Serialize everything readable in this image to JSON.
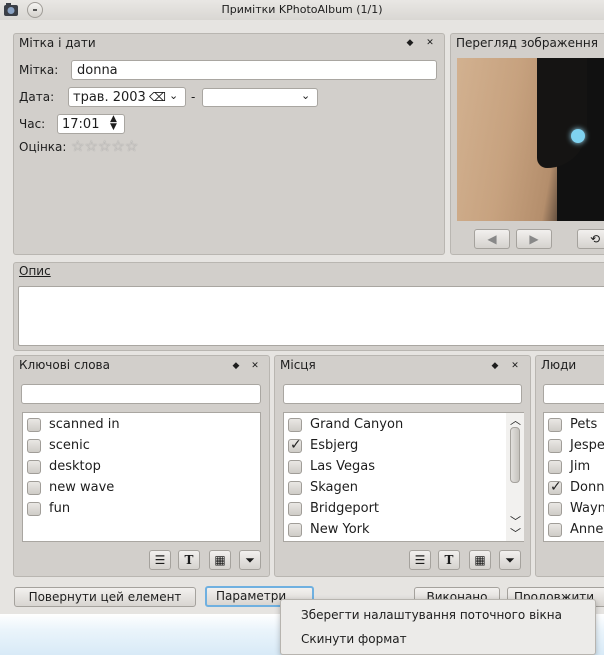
{
  "window": {
    "title": "Примітки KPhotoAlbum (1/1)"
  },
  "labels_panel": {
    "title": "Мітка і дати",
    "label_caption": "Мітка:",
    "label_value": "donna",
    "date_caption": "Дата:",
    "date_from": "трав. 2003",
    "date_separator": "-",
    "date_to": "",
    "time_caption": "Час:",
    "time_value": "17:01",
    "rating_caption": "Оцінка:",
    "rating": 0,
    "rating_max": 5
  },
  "preview_panel": {
    "title": "Перегляд зображення"
  },
  "description_panel": {
    "title": "Опис",
    "value": ""
  },
  "keywords_panel": {
    "title": "Ключові слова",
    "search": "",
    "items": [
      {
        "label": "scanned in",
        "checked": false
      },
      {
        "label": "scenic",
        "checked": false
      },
      {
        "label": "desktop",
        "checked": false
      },
      {
        "label": "new wave",
        "checked": false
      },
      {
        "label": "fun",
        "checked": false
      }
    ]
  },
  "places_panel": {
    "title": "Місця",
    "search": "",
    "items": [
      {
        "label": "Grand Canyon",
        "checked": false
      },
      {
        "label": "Esbjerg",
        "checked": true
      },
      {
        "label": "Las Vegas",
        "checked": false
      },
      {
        "label": "Skagen",
        "checked": false
      },
      {
        "label": "Bridgeport",
        "checked": false
      },
      {
        "label": "New York",
        "checked": false
      }
    ]
  },
  "people_panel": {
    "title": "Люди",
    "search": "",
    "items": [
      {
        "label": "Pets",
        "checked": false
      },
      {
        "label": "Jespe",
        "checked": false
      },
      {
        "label": "Jim",
        "checked": false
      },
      {
        "label": "Donn",
        "checked": true
      },
      {
        "label": "Wayn",
        "checked": false
      },
      {
        "label": "Anne",
        "checked": false
      }
    ]
  },
  "footer": {
    "revert_label": "Повернути цей елемент",
    "options_label": "Параметри",
    "done_label": "Виконано",
    "continue_label": "Продовжити"
  },
  "options_menu": {
    "items": [
      "Зберегти налаштування поточного вікна",
      "Скинути формат"
    ]
  },
  "icons": {
    "app": "kphotoalbum-icon",
    "menu": "window-menu-icon",
    "float": "float-icon",
    "close": "close-icon",
    "clear": "clear-icon",
    "rotate": "rotate-icon"
  },
  "colors": {
    "panel": "#d2cfcb",
    "window": "#e6e4e1",
    "focus": "#6fb0e0"
  }
}
